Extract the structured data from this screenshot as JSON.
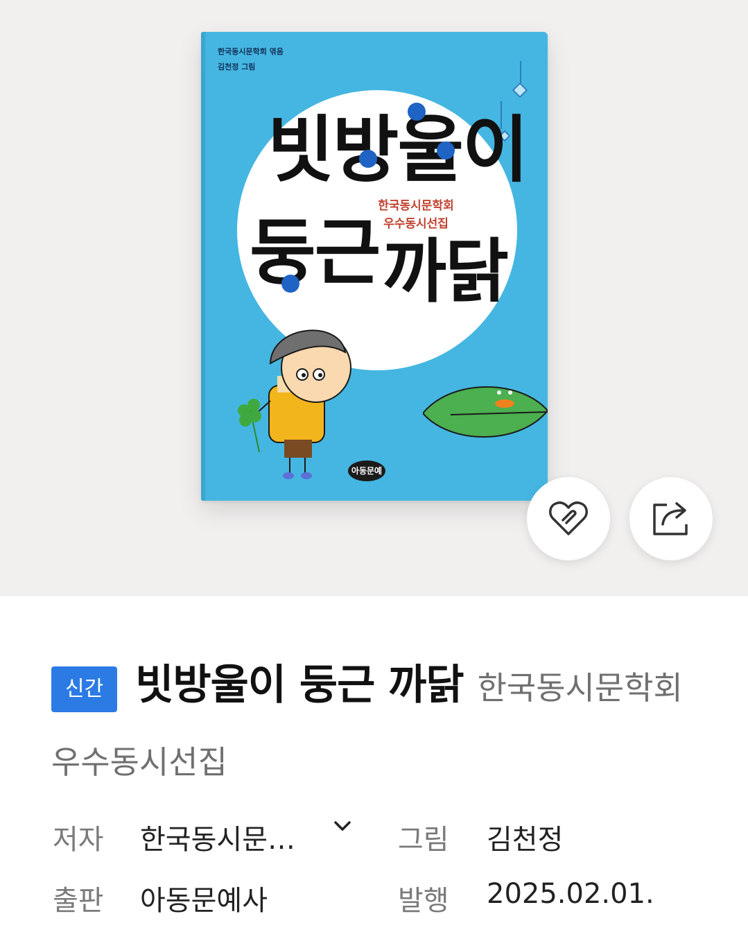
{
  "cover": {
    "credit_line1": "한국동시문학회 엮음",
    "credit_line2": "김천정 그림",
    "title_line1": "빗방울이",
    "title_line2_a": "둥근",
    "title_line2_b": "까닭",
    "subtitle_line1": "한국동시문학회",
    "subtitle_line2": "우수동시선집",
    "publisher_logo": "아동문예"
  },
  "actions": {
    "like_icon": "heart-icon",
    "share_icon": "share-icon"
  },
  "book": {
    "badge": "신간",
    "title": "빗방울이 둥근 까닭",
    "subtitle": "한국동시문학회 우수동시선집"
  },
  "meta": {
    "author_label": "저자",
    "author_value": "한국동시문…",
    "illustrator_label": "그림",
    "illustrator_value": "김천정",
    "publisher_label": "출판",
    "publisher_value": "아동문예사",
    "date_label": "발행",
    "date_value": "2025.02.01."
  },
  "colors": {
    "badge": "#2c7be5",
    "hero_background": "#f1f0ef",
    "cover_blue": "#45b6e1"
  }
}
